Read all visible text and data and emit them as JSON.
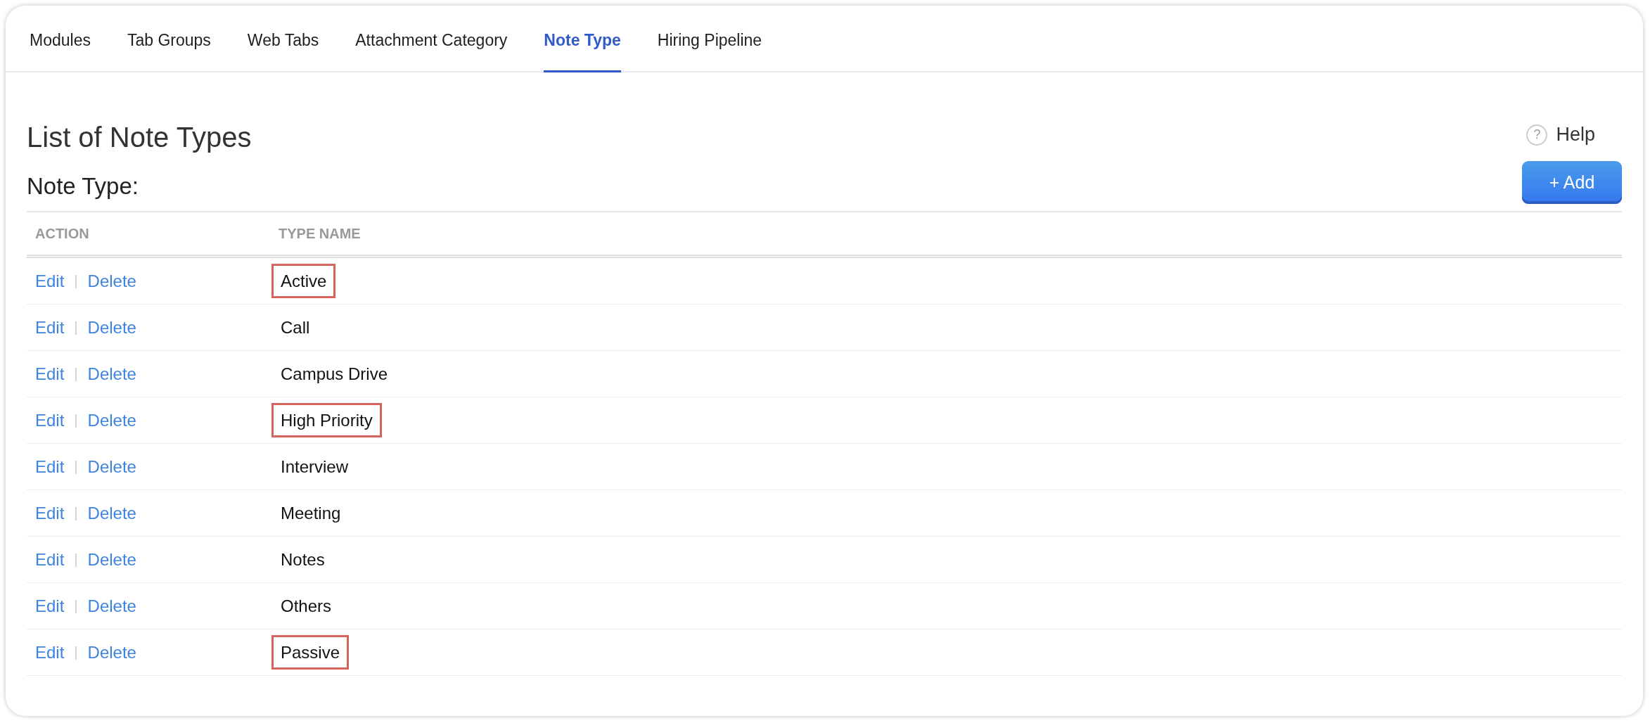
{
  "tabs": [
    {
      "label": "Modules",
      "selected": false
    },
    {
      "label": "Tab Groups",
      "selected": false
    },
    {
      "label": "Web Tabs",
      "selected": false
    },
    {
      "label": "Attachment Category",
      "selected": false
    },
    {
      "label": "Note Type",
      "selected": true
    },
    {
      "label": "Hiring Pipeline",
      "selected": false
    }
  ],
  "page_title": "List of Note Types",
  "help": {
    "icon": "?",
    "label": "Help"
  },
  "section_title": "Note Type:",
  "add_button": "+ Add",
  "table": {
    "columns": [
      "ACTION",
      "TYPE NAME"
    ],
    "rows": [
      {
        "edit": "Edit",
        "separator": "|",
        "delete": "Delete",
        "type_name": "Active",
        "highlighted": true
      },
      {
        "edit": "Edit",
        "separator": "|",
        "delete": "Delete",
        "type_name": "Call",
        "highlighted": false
      },
      {
        "edit": "Edit",
        "separator": "|",
        "delete": "Delete",
        "type_name": "Campus Drive",
        "highlighted": false
      },
      {
        "edit": "Edit",
        "separator": "|",
        "delete": "Delete",
        "type_name": "High Priority",
        "highlighted": true
      },
      {
        "edit": "Edit",
        "separator": "|",
        "delete": "Delete",
        "type_name": "Interview",
        "highlighted": false
      },
      {
        "edit": "Edit",
        "separator": "|",
        "delete": "Delete",
        "type_name": "Meeting",
        "highlighted": false
      },
      {
        "edit": "Edit",
        "separator": "|",
        "delete": "Delete",
        "type_name": "Notes",
        "highlighted": false
      },
      {
        "edit": "Edit",
        "separator": "|",
        "delete": "Delete",
        "type_name": "Others",
        "highlighted": false
      },
      {
        "edit": "Edit",
        "separator": "|",
        "delete": "Delete",
        "type_name": "Passive",
        "highlighted": true
      }
    ]
  }
}
